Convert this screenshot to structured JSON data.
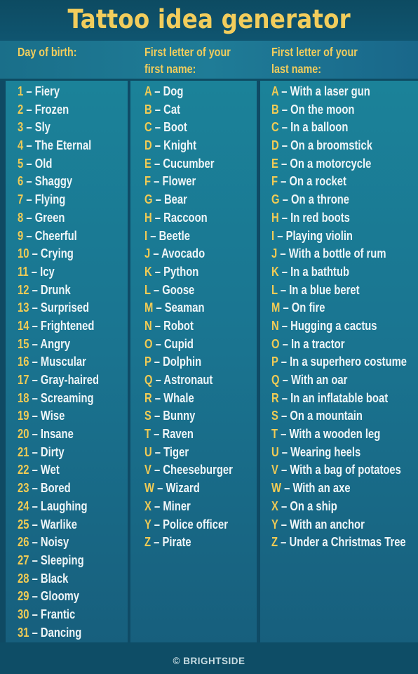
{
  "title": "Tattoo idea generator",
  "headers": {
    "col1": [
      "Day of birth:"
    ],
    "col2": [
      "First letter of your",
      "first name:"
    ],
    "col3": [
      "First letter of your",
      "last name:"
    ]
  },
  "colors": {
    "accent_yellow": "#f0cb55",
    "text_white": "#eef5f7",
    "background_dark": "#0f4a63",
    "panel_teal": "#1a7591"
  },
  "day_of_birth": [
    {
      "key": "1",
      "value": "Fiery"
    },
    {
      "key": "2",
      "value": "Frozen"
    },
    {
      "key": "3",
      "value": "Sly"
    },
    {
      "key": "4",
      "value": "The Eternal"
    },
    {
      "key": "5",
      "value": "Old"
    },
    {
      "key": "6",
      "value": "Shaggy"
    },
    {
      "key": "7",
      "value": "Flying"
    },
    {
      "key": "8",
      "value": "Green"
    },
    {
      "key": "9",
      "value": "Cheerful"
    },
    {
      "key": "10",
      "value": "Crying"
    },
    {
      "key": "11",
      "value": "Icy"
    },
    {
      "key": "12",
      "value": "Drunk"
    },
    {
      "key": "13",
      "value": "Surprised"
    },
    {
      "key": "14",
      "value": "Frightened"
    },
    {
      "key": "15",
      "value": "Angry"
    },
    {
      "key": "16",
      "value": "Muscular"
    },
    {
      "key": "17",
      "value": "Gray-haired"
    },
    {
      "key": "18",
      "value": "Screaming"
    },
    {
      "key": "19",
      "value": "Wise"
    },
    {
      "key": "20",
      "value": "Insane"
    },
    {
      "key": "21",
      "value": "Dirty"
    },
    {
      "key": "22",
      "value": "Wet"
    },
    {
      "key": "23",
      "value": "Bored"
    },
    {
      "key": "24",
      "value": "Laughing"
    },
    {
      "key": "25",
      "value": "Warlike"
    },
    {
      "key": "26",
      "value": "Noisy"
    },
    {
      "key": "27",
      "value": "Sleeping"
    },
    {
      "key": "28",
      "value": "Black"
    },
    {
      "key": "29",
      "value": "Gloomy"
    },
    {
      "key": "30",
      "value": "Frantic"
    },
    {
      "key": "31",
      "value": "Dancing"
    }
  ],
  "first_name": [
    {
      "key": "A",
      "value": "Dog"
    },
    {
      "key": "B",
      "value": "Cat"
    },
    {
      "key": "C",
      "value": "Boot"
    },
    {
      "key": "D",
      "value": "Knight"
    },
    {
      "key": "E",
      "value": "Cucumber"
    },
    {
      "key": "F",
      "value": "Flower"
    },
    {
      "key": "G",
      "value": "Bear"
    },
    {
      "key": "H",
      "value": "Raccoon"
    },
    {
      "key": "I",
      "value": "Beetle"
    },
    {
      "key": "J",
      "value": "Avocado"
    },
    {
      "key": "K",
      "value": "Python"
    },
    {
      "key": "L",
      "value": "Goose"
    },
    {
      "key": "M",
      "value": "Seaman"
    },
    {
      "key": "N",
      "value": "Robot"
    },
    {
      "key": "O",
      "value": "Cupid"
    },
    {
      "key": "P",
      "value": "Dolphin"
    },
    {
      "key": "Q",
      "value": "Astronaut"
    },
    {
      "key": "R",
      "value": "Whale"
    },
    {
      "key": "S",
      "value": "Bunny"
    },
    {
      "key": "T",
      "value": "Raven"
    },
    {
      "key": "U",
      "value": "Tiger"
    },
    {
      "key": "V",
      "value": "Cheeseburger"
    },
    {
      "key": "W",
      "value": "Wizard"
    },
    {
      "key": "X",
      "value": "Miner"
    },
    {
      "key": "Y",
      "value": "Police officer"
    },
    {
      "key": "Z",
      "value": "Pirate"
    }
  ],
  "last_name": [
    {
      "key": "A",
      "value": "With a laser gun"
    },
    {
      "key": "B",
      "value": "On the moon"
    },
    {
      "key": "C",
      "value": "In a balloon"
    },
    {
      "key": "D",
      "value": "On a broomstick"
    },
    {
      "key": "E",
      "value": "On a motorcycle"
    },
    {
      "key": "F",
      "value": "On a rocket"
    },
    {
      "key": "G",
      "value": "On a throne"
    },
    {
      "key": "H",
      "value": "In red boots"
    },
    {
      "key": "I",
      "value": "Playing violin"
    },
    {
      "key": "J",
      "value": "With a bottle of rum"
    },
    {
      "key": "K",
      "value": "In a bathtub"
    },
    {
      "key": "L",
      "value": "In a blue beret"
    },
    {
      "key": "M",
      "value": "On fire"
    },
    {
      "key": "N",
      "value": "Hugging a cactus"
    },
    {
      "key": "O",
      "value": "In a tractor"
    },
    {
      "key": "P",
      "value": "In a superhero costume"
    },
    {
      "key": "Q",
      "value": "With an oar"
    },
    {
      "key": "R",
      "value": "In an inflatable boat"
    },
    {
      "key": "S",
      "value": "On a mountain"
    },
    {
      "key": "T",
      "value": "With a wooden leg"
    },
    {
      "key": "U",
      "value": "Wearing heels"
    },
    {
      "key": "V",
      "value": "With a bag of potatoes"
    },
    {
      "key": "W",
      "value": "With an axe"
    },
    {
      "key": "X",
      "value": "On a ship"
    },
    {
      "key": "Y",
      "value": "With an anchor"
    },
    {
      "key": "Z",
      "value": "Under a Christmas Tree"
    }
  ],
  "separator": " – ",
  "footer": {
    "copyright_symbol": "©",
    "brand": "BRIGHTSIDE"
  }
}
